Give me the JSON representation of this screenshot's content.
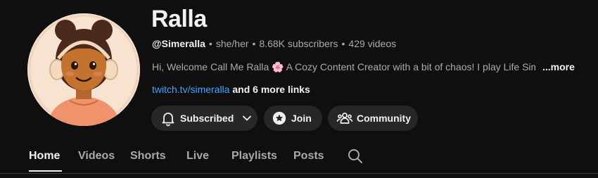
{
  "channel": {
    "name": "Ralla",
    "handle": "@Simeralla",
    "pronouns": "she/her",
    "subscribers": "8.68K subscribers",
    "videos": "429 videos",
    "separator": "•",
    "description_before": "Hi, Welcome Call Me Ralla",
    "description_emoji": "🌸",
    "description_after": "A Cozy Content Creator with a bit of chaos! I play Life Sim",
    "more": "...more",
    "link": "twitch.tv/simeralla",
    "more_links": "and 6 more links"
  },
  "buttons": {
    "subscribed": "Subscribed",
    "join": "Join",
    "community": "Community"
  },
  "tabs": [
    "Home",
    "Videos",
    "Shorts",
    "Live",
    "Playlists",
    "Posts"
  ],
  "active_tab": "Home",
  "colors": {
    "background": "#0f0f0f",
    "button_bg": "#272727",
    "link": "#3ea6ff",
    "muted_text": "#aaaaaa"
  },
  "icons": [
    "bell-icon",
    "chevron-down-icon",
    "star-icon",
    "community-icon",
    "search-icon"
  ]
}
